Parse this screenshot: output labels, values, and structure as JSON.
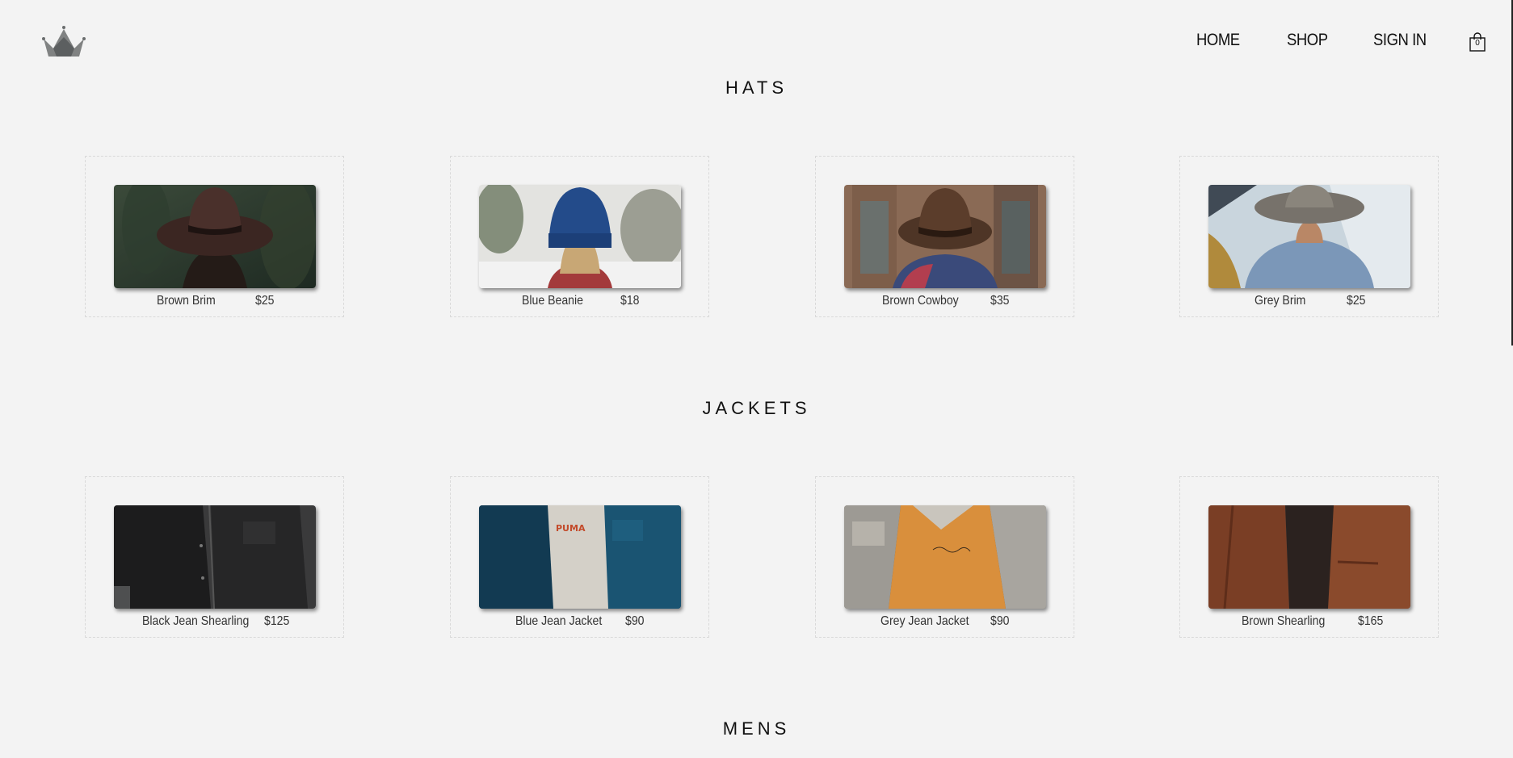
{
  "header": {
    "logo_icon": "crown-icon",
    "nav": [
      {
        "label": "HOME"
      },
      {
        "label": "SHOP"
      },
      {
        "label": "SIGN IN"
      }
    ],
    "cart": {
      "icon": "shopping-bag-icon",
      "count": "0"
    }
  },
  "sections": [
    {
      "title": "HATS",
      "items": [
        {
          "name": "Brown Brim",
          "price": "$25"
        },
        {
          "name": "Blue Beanie",
          "price": "$18"
        },
        {
          "name": "Brown Cowboy",
          "price": "$35"
        },
        {
          "name": "Grey Brim",
          "price": "$25"
        }
      ]
    },
    {
      "title": "JACKETS",
      "items": [
        {
          "name": "Black Jean Shearling",
          "price": "$125"
        },
        {
          "name": "Blue Jean Jacket",
          "price": "$90"
        },
        {
          "name": "Grey Jean Jacket",
          "price": "$90"
        },
        {
          "name": "Brown Shearling",
          "price": "$165"
        }
      ]
    },
    {
      "title": "MENS",
      "items": []
    }
  ],
  "colors": {
    "background": "#f3f3f3",
    "text": "#111111",
    "card_border": "#d9d9d9"
  }
}
